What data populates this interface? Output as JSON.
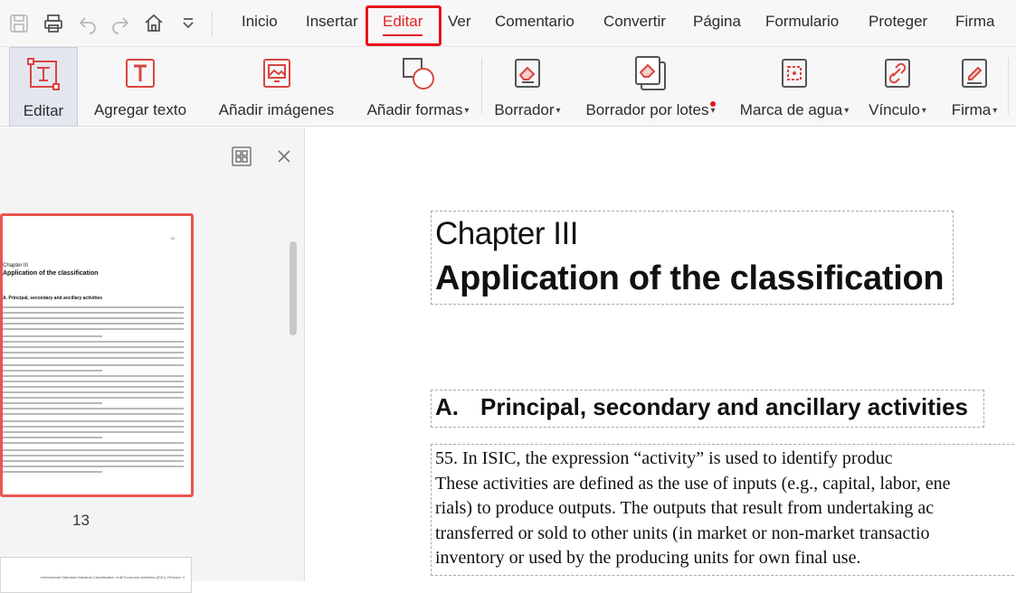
{
  "menubar": {
    "items": [
      "Inicio",
      "Insertar",
      "Editar",
      "Ver",
      "Comentario",
      "Convertir",
      "Página",
      "Formulario",
      "Proteger",
      "Firma"
    ],
    "active": "Editar"
  },
  "ribbon": {
    "tools": [
      {
        "label": "Editar",
        "has_caret": false
      },
      {
        "label": "Agregar texto",
        "has_caret": false
      },
      {
        "label": "Añadir imágenes",
        "has_caret": false
      },
      {
        "label": "Añadir formas",
        "has_caret": true
      },
      {
        "label": "Borrador",
        "has_caret": true
      },
      {
        "label": "Borrador por lotes",
        "has_caret": true
      },
      {
        "label": "Marca de agua",
        "has_caret": true
      },
      {
        "label": "Vínculo",
        "has_caret": true
      },
      {
        "label": "Firma",
        "has_caret": true
      }
    ],
    "caret_glyph": "▾"
  },
  "thumbnails": {
    "page_13": {
      "number": "13",
      "page_label": "31",
      "chapter": "Chapter III",
      "title": "Application of the classification",
      "section": "A.  Principal, secondary and ancillary activities"
    },
    "page_14": {
      "header": "International Standard Industrial Classification of All Economic Activities (ISIC), Revision 4"
    }
  },
  "document": {
    "chapter": "Chapter III",
    "title": "Application of the classification",
    "section_letter": "A.",
    "section_title": "Principal, secondary and ancillary activities",
    "paragraph_lines": [
      "      55.    In ISIC, the expression “activity” is used to identify produc",
      "These activities are defined as the use of inputs (e.g., capital, labor, ene",
      "rials) to produce outputs. The outputs that result from undertaking ac",
      "transferred or sold to other units (in market or non-market transactio",
      "inventory or used by the producing units for own final use."
    ]
  },
  "colors": {
    "accent_red": "#e0241f",
    "highlight_box": "#e8141b",
    "thumb_border": "#e8554f",
    "icon_red": "#d9453f"
  }
}
